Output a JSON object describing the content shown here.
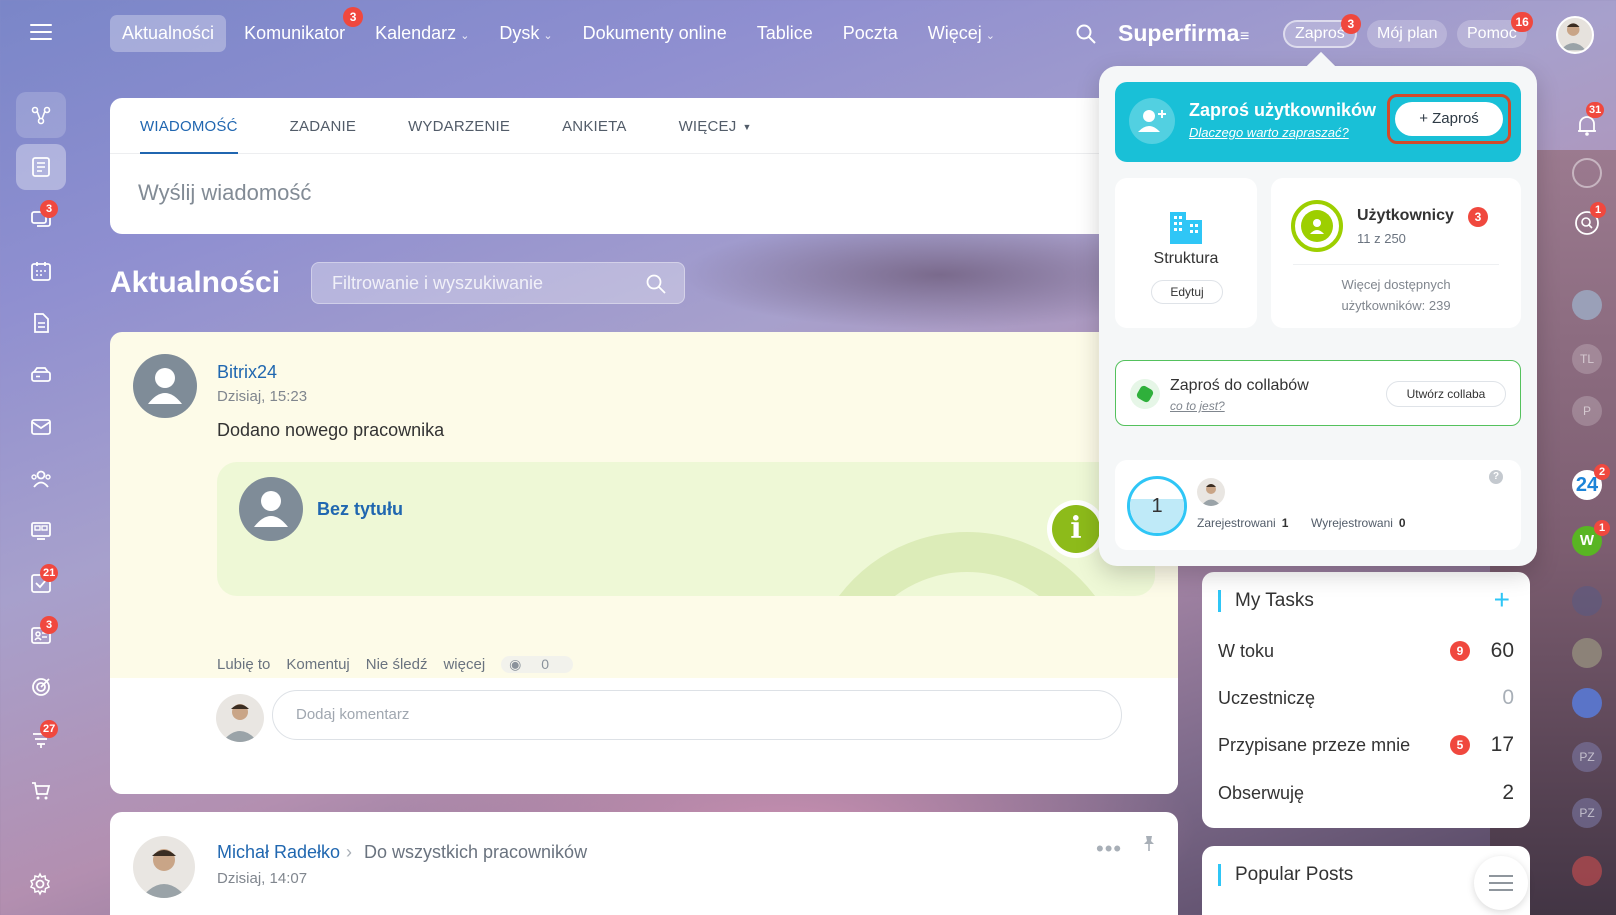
{
  "topbar": {
    "nav": [
      {
        "label": "Aktualności",
        "active": true
      },
      {
        "label": "Komunikator",
        "badge": "3"
      },
      {
        "label": "Kalendarz",
        "dropdown": true
      },
      {
        "label": "Dysk",
        "dropdown": true
      },
      {
        "label": "Dokumenty online"
      },
      {
        "label": "Tablice"
      },
      {
        "label": "Poczta"
      },
      {
        "label": "Więcej",
        "dropdown": true
      }
    ],
    "brand": "Superfirma",
    "invite_label": "Zaproś",
    "invite_badge": "3",
    "plan_label": "Mój plan",
    "help_label": "Pomoc",
    "help_badge": "16"
  },
  "leftbar": {
    "items": [
      {
        "icon": "workflow-icon"
      },
      {
        "icon": "feed-icon",
        "selected": true
      },
      {
        "icon": "chat-icon",
        "badge": "3"
      },
      {
        "icon": "calendar-icon"
      },
      {
        "icon": "document-icon"
      },
      {
        "icon": "drive-icon"
      },
      {
        "icon": "mail-icon"
      },
      {
        "icon": "employees-icon"
      },
      {
        "icon": "boards-icon"
      },
      {
        "icon": "tasks-icon",
        "badge": "21"
      },
      {
        "icon": "crm-icon",
        "badge": "3"
      },
      {
        "icon": "goals-icon"
      },
      {
        "icon": "automation-icon",
        "badge": "27"
      },
      {
        "icon": "cart-icon"
      }
    ]
  },
  "composer": {
    "tabs": [
      "WIADOMOŚĆ",
      "ZADANIE",
      "WYDARZENIE",
      "ANKIETA",
      "WIĘCEJ"
    ],
    "placeholder": "Wyślij wiadomość"
  },
  "feed": {
    "title": "Aktualności",
    "search_placeholder": "Filtrowanie i wyszukiwanie"
  },
  "post1": {
    "author": "Bitrix24",
    "time": "Dzisiaj, 15:23",
    "text": "Dodano nowego pracownika",
    "card_title": "Bez tytułu",
    "actions": [
      "Lubię to",
      "Komentuj",
      "Nie śledź",
      "więcej"
    ],
    "views": "0",
    "comment_placeholder": "Dodaj komentarz"
  },
  "post2": {
    "author": "Michał Radełko",
    "destination": "Do wszystkich pracowników",
    "time": "Dzisiaj, 14:07"
  },
  "tasks": {
    "title": "My Tasks",
    "rows": [
      {
        "label": "W toku",
        "badge": "9",
        "count": "60"
      },
      {
        "label": "Uczestniczę",
        "badge": "",
        "count": "0"
      },
      {
        "label": "Przypisane przeze mnie",
        "badge": "5",
        "count": "17"
      },
      {
        "label": "Obserwuję",
        "badge": "",
        "count": "2"
      }
    ]
  },
  "popular": {
    "title": "Popular Posts"
  },
  "rail": {
    "notif_badge": "31",
    "chat_badge": "1",
    "b24_label": "24",
    "b24_badge": "2",
    "w_label": "W",
    "w_badge": "1",
    "tl": "TL",
    "p": "P",
    "pz1": "PZ",
    "pz2": "PZ"
  },
  "popup": {
    "invite_title": "Zaproś użytkowników",
    "invite_sub": "Dlaczego warto zapraszać?",
    "invite_button": "+ Zaproś",
    "struct_label": "Struktura",
    "struct_button": "Edytuj",
    "users_title": "Użytkownicy",
    "users_badge": "3",
    "users_count": "11 z 250",
    "users_more_1": "Więcej dostępnych",
    "users_more_2": "użytkowników: 239",
    "collab_title": "Zaproś do collabów",
    "collab_sub": "co to jest?",
    "collab_button": "Utwórz collaba",
    "stats_number": "1",
    "registered_label": "Zarejestrowani",
    "registered_value": "1",
    "unregistered_label": "Wyrejestrowani",
    "unregistered_value": "0",
    "help_mark": "?"
  }
}
